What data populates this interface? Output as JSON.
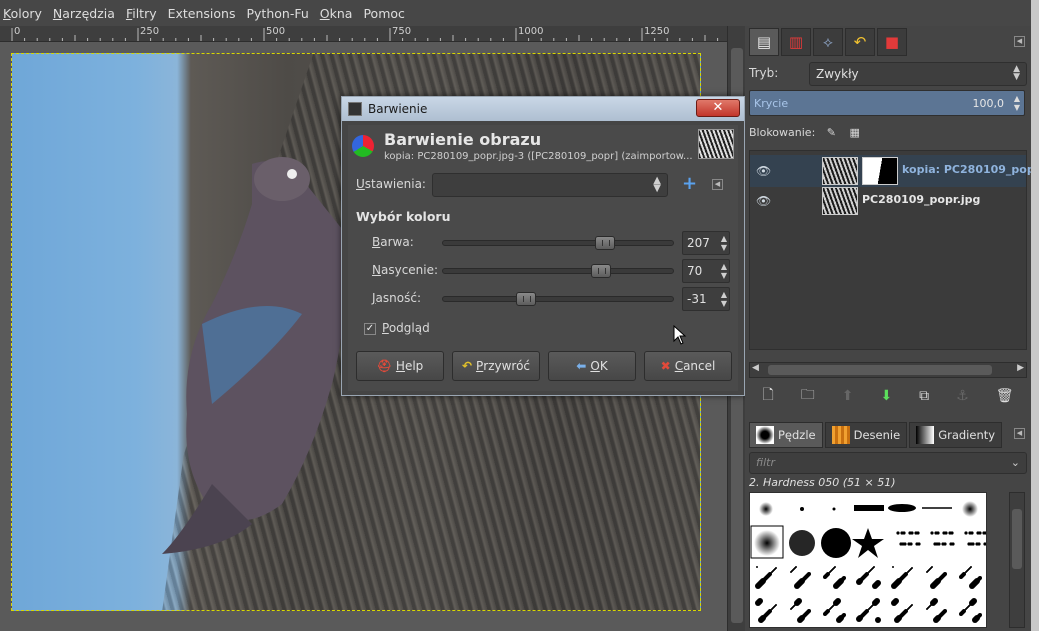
{
  "menubar": {
    "items": [
      {
        "pre": "",
        "ul": "K",
        "post": "olory"
      },
      {
        "pre": "",
        "ul": "N",
        "post": "arzędzia"
      },
      {
        "pre": "",
        "ul": "F",
        "post": "iltry"
      },
      {
        "pre": "",
        "ul": "",
        "post": "Extensions"
      },
      {
        "pre": "",
        "ul": "",
        "post": "Python-Fu"
      },
      {
        "pre": "",
        "ul": "O",
        "post": "kna"
      },
      {
        "pre": "",
        "ul": "",
        "post": "Pomoc"
      }
    ]
  },
  "ruler": {
    "labels": [
      "0",
      "250",
      "500",
      "750",
      "1000",
      "1250"
    ]
  },
  "dialog": {
    "window_title": "Barwienie",
    "close_glyph": "✕",
    "title": "Barwienie obrazu",
    "subtitle": "kopia: PC280109_popr.jpg-3 ([PC280109_popr] (zaimportow...",
    "settings": {
      "label_ul": "U",
      "label_rest": "stawienia:",
      "value": "",
      "add_glyph": "+"
    },
    "section_title": "Wybór koloru",
    "sliders": [
      {
        "name": "hue",
        "label_ul": "B",
        "label_rest": "arwa:",
        "value": "207",
        "min": -180,
        "max": 360
      },
      {
        "name": "saturation",
        "label_ul": "N",
        "label_rest": "asycenie:",
        "value": "70",
        "min": 0,
        "max": 100
      },
      {
        "name": "lightness",
        "label_ul": "J",
        "label_rest": "asność:",
        "value": "-31",
        "min": -100,
        "max": 100
      }
    ],
    "preview": {
      "label_ul": "P",
      "label_rest": "odgląd",
      "checked": true,
      "check_glyph": "✓"
    },
    "buttons": [
      {
        "name": "help",
        "icon": "⛑",
        "icon_color": "#e24a3a",
        "label_ul": "H",
        "label_rest": "elp"
      },
      {
        "name": "reset",
        "icon": "↶",
        "icon_color": "#e3c22a",
        "label_ul": "P",
        "label_rest": "rzywróć"
      },
      {
        "name": "ok",
        "icon": "⬅",
        "icon_color": "#7ab0ea",
        "label_ul": "O",
        "label_rest": "K"
      },
      {
        "name": "cancel",
        "icon": "✖",
        "icon_color": "#e24a3a",
        "label_ul": "C",
        "label_rest": "ancel"
      }
    ]
  },
  "dock": {
    "tabs": [
      {
        "name": "layers",
        "glyph": "▤",
        "color": "#e8e8e8"
      },
      {
        "name": "channels",
        "glyph": "▥",
        "color": "#e23a3a"
      },
      {
        "name": "paths",
        "glyph": "⟡",
        "color": "#8aa0c0"
      },
      {
        "name": "undo",
        "glyph": "↶",
        "color": "#f2c230"
      },
      {
        "name": "stop",
        "glyph": "■",
        "color": "#e23a3a"
      }
    ],
    "mode_label": "Tryb:",
    "mode_value": "Zwykły",
    "opacity_label": "Krycie",
    "opacity_value": "100,0",
    "lock_label": "Blokowanie:",
    "layers": [
      {
        "name": "kopia: PC280109_popr",
        "active": true,
        "has_mask": true
      },
      {
        "name": "PC280109_popr.jpg",
        "active": false,
        "has_mask": false
      }
    ],
    "brush_tabs": [
      {
        "name": "brushes",
        "label": "Pędzle",
        "swatch": "radial-gradient(#000 30%, #fff 70%)"
      },
      {
        "name": "patterns",
        "label": "Desenie",
        "swatch": "repeating-linear-gradient(90deg, #f0a030 0 3px, #c87010 3px 6px)"
      },
      {
        "name": "gradients",
        "label": "Gradienty",
        "swatch": "linear-gradient(90deg, #000, #fff)"
      }
    ],
    "filter_placeholder": "filtr",
    "brush_name": "2. Hardness 050 (51 × 51)"
  }
}
